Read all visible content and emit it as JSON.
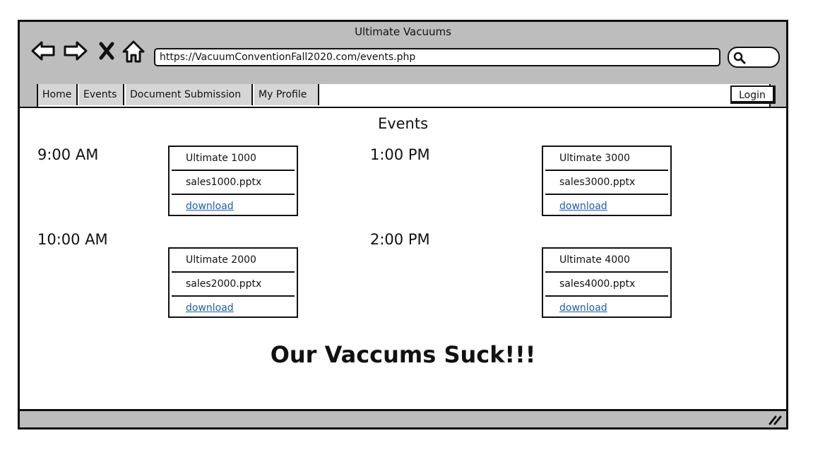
{
  "window": {
    "title": "Ultimate Vacuums"
  },
  "browser": {
    "url": "https://VacuumConventionFall2020.com/events.php"
  },
  "nav": {
    "tabs": [
      {
        "label": "Home"
      },
      {
        "label": "Events"
      },
      {
        "label": "Document Submission"
      },
      {
        "label": "My Profile"
      }
    ],
    "login_label": "Login"
  },
  "page": {
    "heading": "Events",
    "events": [
      {
        "time": "9:00 AM",
        "product": "Ultimate 1000",
        "file": "sales1000.pptx",
        "link": "download"
      },
      {
        "time": "10:00 AM",
        "product": "Ultimate 2000",
        "file": "sales2000.pptx",
        "link": "download"
      },
      {
        "time": "1:00 PM",
        "product": "Ultimate 3000",
        "file": "sales3000.pptx",
        "link": "download"
      },
      {
        "time": "2:00 PM",
        "product": "Ultimate 4000",
        "file": "sales4000.pptx",
        "link": "download"
      }
    ],
    "slogan": "Our Vaccums Suck!!!"
  },
  "colors": {
    "chrome": "#bdbdbd",
    "link": "#1f5fa8"
  },
  "icons": [
    "back-arrow-icon",
    "forward-arrow-icon",
    "close-x-icon",
    "home-icon",
    "search-icon",
    "resize-grip-icon"
  ]
}
